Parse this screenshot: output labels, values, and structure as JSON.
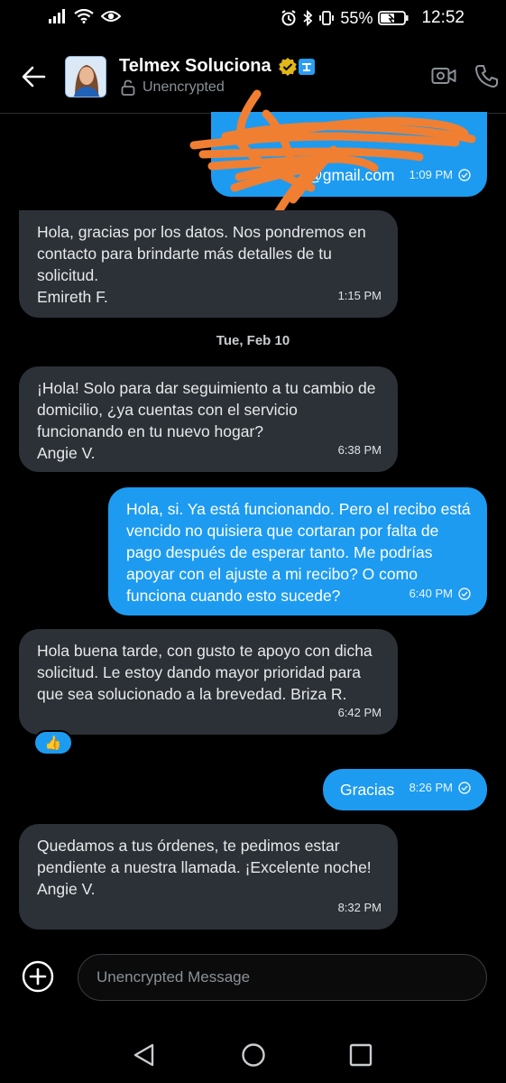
{
  "status_bar": {
    "battery": "55%",
    "time": "12:52"
  },
  "header": {
    "contact_name": "Telmex Soluciona",
    "encryption": "Unencrypted"
  },
  "messages": [
    {
      "id": "m0",
      "text": "@gmail.com",
      "time": "1:09 PM"
    },
    {
      "id": "m1",
      "text": "Hola, gracias por los datos. Nos pondremos en contacto para brindarte más detalles de tu solicitud.\nEmireth F.",
      "time": "1:15 PM"
    },
    {
      "id": "m2",
      "text": "¡Hola! Solo para dar seguimiento a tu cambio de domicilio, ¿ya cuentas con el servicio funcionando en tu nuevo hogar?\nAngie V.",
      "time": "6:38 PM"
    },
    {
      "id": "m3",
      "text": "Hola, si. Ya está funcionando. Pero el recibo está vencido no quisiera que cortaran por falta de pago después de esperar tanto. Me podrías apoyar con el ajuste a mi recibo? O como funciona cuando esto sucede?",
      "time": "6:40 PM"
    },
    {
      "id": "m4",
      "text": "Hola buena tarde, con gusto te apoyo con dicha solicitud. Le estoy dando mayor prioridad para que sea solucionado a la brevedad. Briza R.",
      "time": "6:42 PM",
      "reaction": "👍"
    },
    {
      "id": "m5",
      "text": "Gracias",
      "time": "8:26 PM"
    },
    {
      "id": "m6",
      "text": "Quedamos a tus órdenes, te pedimos estar pendiente a nuestra llamada. ¡Excelente noche!\nAngie V.",
      "time": "8:32 PM"
    }
  ],
  "date_separator": "Tue, Feb 10",
  "composer": {
    "placeholder": "Unencrypted Message"
  },
  "colors": {
    "outgoing_bubble": "#1d9bf0",
    "incoming_bubble": "#2c3137",
    "background": "#000000",
    "redaction_scribble": "#f07f32"
  }
}
